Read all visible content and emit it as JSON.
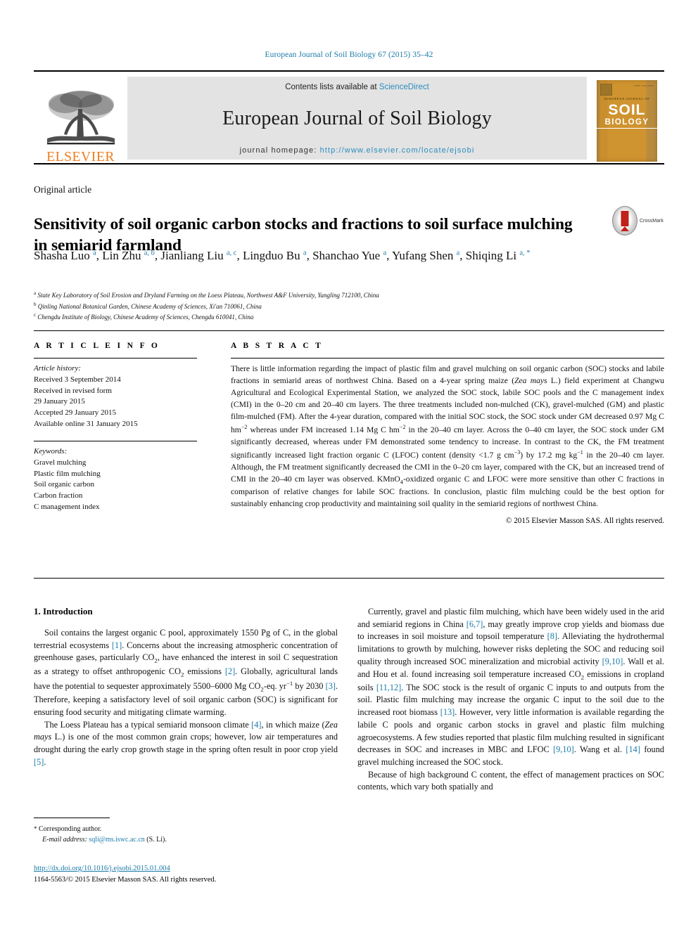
{
  "running_head": "European Journal of Soil Biology 67 (2015) 35–42",
  "masthead": {
    "publisher_name": "ELSEVIER",
    "contents_prefix": "Contents lists available at ",
    "contents_link": "ScienceDirect",
    "journal_title": "European Journal of Soil Biology",
    "homepage_prefix": "journal homepage: ",
    "homepage_url": "http://www.elsevier.com/locate/ejsobi",
    "cover": {
      "eyebrow": "EUROPEAN JOURNAL OF",
      "line1": "SOIL",
      "line2": "BIOLOGY",
      "issn_corner": "ISSN 1164-5563"
    }
  },
  "article": {
    "type": "Original article",
    "title": "Sensitivity of soil organic carbon stocks and fractions to soil surface mulching in semiarid farmland",
    "crossmark_label": "CrossMark",
    "authors_html": "Shasha Luo <sup>a</sup>, Lin Zhu <sup>a, b</sup>, Jianliang Liu <sup>a, c</sup>, Lingduo Bu <sup>a</sup>, Shanchao Yue <sup>a</sup>, Yufang Shen <sup>a</sup>, Shiqing Li <sup>a, *</sup>",
    "affiliations": [
      {
        "marker": "a",
        "text": "State Key Laboratory of Soil Erosion and Dryland Farming on the Loess Plateau, Northwest A&F University, Yangling 712100, China"
      },
      {
        "marker": "b",
        "text": "Qinling National Botanical Garden, Chinese Academy of Sciences, Xi'an 710061, China"
      },
      {
        "marker": "c",
        "text": "Chengdu Institute of Biology, Chinese Academy of Sciences, Chengdu 610041, China"
      }
    ]
  },
  "article_info": {
    "heading": "A R T I C L E  I N F O",
    "history_label": "Article history:",
    "history": [
      "Received 3 September 2014",
      "Received in revised form",
      "29 January 2015",
      "Accepted 29 January 2015",
      "Available online 31 January 2015"
    ],
    "keywords_label": "Keywords:",
    "keywords": [
      "Gravel mulching",
      "Plastic film mulching",
      "Soil organic carbon",
      "Carbon fraction",
      "C management index"
    ]
  },
  "abstract": {
    "heading": "A B S T R A C T",
    "body_html": "There is little information regarding the impact of plastic film and gravel mulching on soil organic carbon (SOC) stocks and labile fractions in semiarid areas of northwest China. Based on a 4-year spring maize (<span class=\"it\">Zea mays</span> L.) field experiment at Changwu Agricultural and Ecological Experimental Station, we analyzed the SOC stock, labile SOC pools and the C management index (CMI) in the 0–20 cm and 20–40 cm layers. The three treatments included non-mulched (CK), gravel-mulched (GM) and plastic film-mulched (FM). After the 4-year duration, compared with the initial SOC stock, the SOC stock under GM decreased 0.97 Mg C hm<sup class=\"num\">−2</sup> whereas under FM increased 1.14 Mg C hm<sup class=\"num\">−2</sup> in the 20–40 cm layer. Across the 0–40 cm layer, the SOC stock under GM significantly decreased, whereas under FM demonstrated some tendency to increase. In contrast to the CK, the FM treatment significantly increased light fraction organic C (LFOC) content (density &lt;1.7 g cm<sup class=\"num\">−3</sup>) by 17.2 mg kg<sup class=\"num\">−1</sup> in the 20–40 cm layer. Although, the FM treatment significantly decreased the CMI in the 0–20 cm layer, compared with the CK, but an increased trend of CMI in the 20–40 cm layer was observed. KMnO<sub>4</sub>-oxidized organic C and LFOC were more sensitive than other C fractions in comparison of relative changes for labile SOC fractions. In conclusion, plastic film mulching could be the best option for sustainably enhancing crop productivity and maintaining soil quality in the semiarid regions of northwest China.",
    "copyright": "© 2015 Elsevier Masson SAS. All rights reserved."
  },
  "introduction": {
    "heading": "1. Introduction",
    "left_paragraphs_html": [
      "Soil contains the largest organic C pool, approximately 1550 Pg of C, in the global terrestrial ecosystems <span class=\"ref\">[1]</span>. Concerns about the increasing atmospheric concentration of greenhouse gases, particularly CO<sub>2</sub>, have enhanced the interest in soil C sequestration as a strategy to offset anthropogenic CO<sub>2</sub> emissions <span class=\"ref\">[2]</span>. Globally, agricultural lands have the potential to sequester approximately 5500–6000 Mg CO<sub>2</sub>-eq. yr<sup class=\"num\">−1</sup> by 2030 <span class=\"ref\">[3]</span>. Therefore, keeping a satisfactory level of soil organic carbon (SOC) is significant for ensuring food security and mitigating climate warming.",
      "The Loess Plateau has a typical semiarid monsoon climate <span class=\"ref\">[4]</span>, in which maize (<span class=\"it\">Zea mays</span> L.) is one of the most common grain crops; however, low air temperatures and drought during the early crop growth stage in the spring often result in poor crop yield <span class=\"ref\">[5]</span>."
    ],
    "right_paragraphs_html": [
      "Currently, gravel and plastic film mulching, which have been widely used in the arid and semiarid regions in China <span class=\"ref\">[6,7]</span>, may greatly improve crop yields and biomass due to increases in soil moisture and topsoil temperature <span class=\"ref\">[8]</span>. Alleviating the hydrothermal limitations to growth by mulching, however risks depleting the SOC and reducing soil quality through increased SOC mineralization and microbial activity <span class=\"ref\">[9,10]</span>. Wall et al. and Hou et al. found increasing soil temperature increased CO<sub>2</sub> emissions in cropland soils <span class=\"ref\">[11,12]</span>. The SOC stock is the result of organic C inputs to and outputs from the soil. Plastic film mulching may increase the organic C input to the soil due to the increased root biomass <span class=\"ref\">[13]</span>. However, very little information is available regarding the labile C pools and organic carbon stocks in gravel and plastic film mulching agroecosystems. A few studies reported that plastic film mulching resulted in significant decreases in SOC and increases in MBC and LFOC <span class=\"ref\">[9,10]</span>. Wang et al. <span class=\"ref\">[14]</span> found gravel mulching increased the SOC stock.",
      "Because of high background C content, the effect of management practices on SOC contents, which vary both spatially and"
    ]
  },
  "footer": {
    "corresponding_marker": "*",
    "corresponding_label": "Corresponding author.",
    "email_label": "E-mail address:",
    "email": "sqli@ms.iswc.ac.cn",
    "email_owner": "(S. Li).",
    "doi": "http://dx.doi.org/10.1016/j.ejsobi.2015.01.004",
    "issn_line": "1164-5563/© 2015 Elsevier Masson SAS. All rights reserved."
  },
  "colors": {
    "link": "#1a7aa8",
    "band": "#e3e3e3",
    "elsevier_orange": "#F07C1B",
    "cover_orange": "#cf9430"
  }
}
